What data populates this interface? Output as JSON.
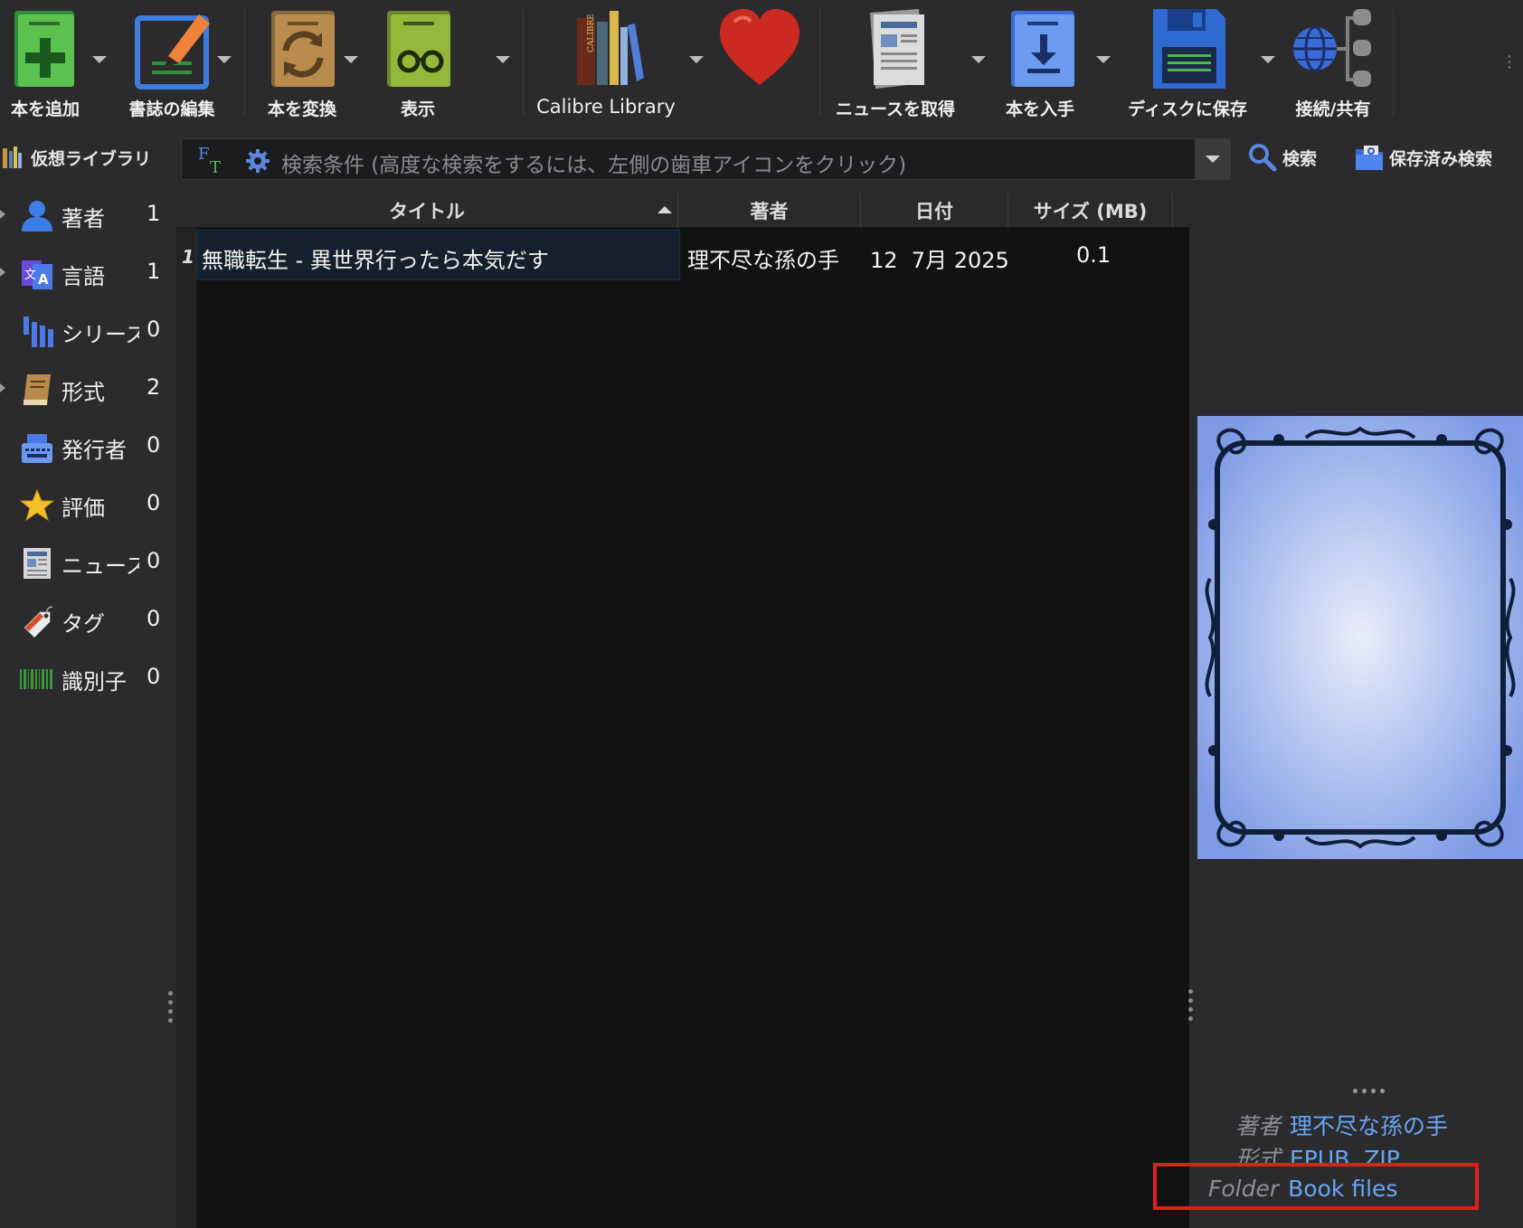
{
  "toolbar": {
    "add_books": "本を追加",
    "edit_metadata": "書誌の編集",
    "convert_books": "本を変換",
    "view": "表示",
    "library": "Calibre Library",
    "fetch_news": "ニュースを取得",
    "get_books": "本を入手",
    "save_to_disk": "ディスクに保存",
    "connect_share": "接続/共有"
  },
  "search": {
    "virtual_library": "仮想ライブラリ",
    "placeholder": "検索条件 (高度な検索をするには、左側の歯車アイコンをクリック)",
    "search_label": "検索",
    "saved_searches_label": "保存済み検索"
  },
  "tag_browser": {
    "categories": [
      {
        "name": "著者",
        "count": "1",
        "icon": "person-icon"
      },
      {
        "name": "言語",
        "count": "1",
        "icon": "language-icon"
      },
      {
        "name": "シリーズ",
        "count": "0",
        "icon": "series-icon"
      },
      {
        "name": "形式",
        "count": "2",
        "icon": "format-icon"
      },
      {
        "name": "発行者",
        "count": "0",
        "icon": "publisher-icon"
      },
      {
        "name": "評価",
        "count": "0",
        "icon": "star-icon"
      },
      {
        "name": "ニュース",
        "count": "0",
        "icon": "news-icon"
      },
      {
        "name": "タグ",
        "count": "0",
        "icon": "tag-icon"
      },
      {
        "name": "識別子",
        "count": "0",
        "icon": "barcode-icon"
      }
    ]
  },
  "book_list": {
    "columns": [
      "タイトル",
      "著者",
      "日付",
      "サイズ (MB)"
    ],
    "rows": [
      {
        "num": "1",
        "title": "無職転生 - 異世界行ったら本気だす",
        "author": "理不尽な孫の手",
        "date": "12  7月 2025",
        "size": "0.1"
      }
    ]
  },
  "details": {
    "author_key": "著者",
    "author_value": "理不尽な孫の手",
    "formats_key": "形式",
    "formats_value": "EPUB, ZIP",
    "folder_key": "Folder",
    "folder_value": "Book files"
  },
  "colors": {
    "background": "#2b2b2d",
    "list_background": "#121212",
    "link": "#67a6f5",
    "highlight_box": "#e21f17",
    "cover_blue": "#7f9be6"
  }
}
